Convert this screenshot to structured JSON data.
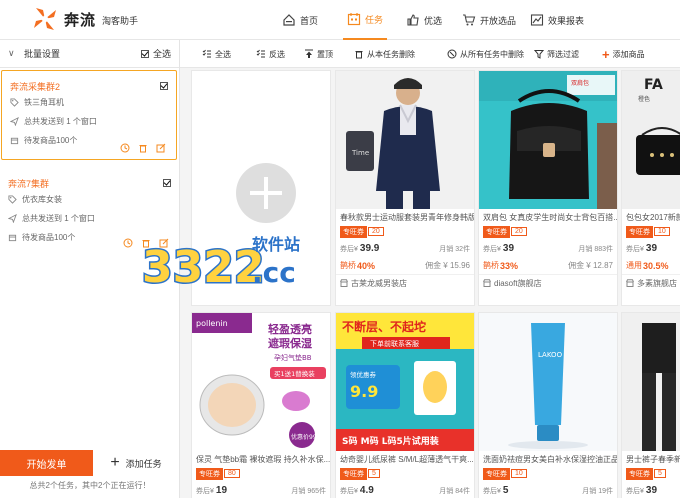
{
  "brand": {
    "name": "奔流",
    "subtitle": "淘客助手",
    "logo_icon": "pinwheel-logo",
    "accent": "#f5891f"
  },
  "nav": [
    {
      "label": "首页",
      "icon": "home-icon"
    },
    {
      "label": "任务",
      "icon": "calendar-icon",
      "active": true
    },
    {
      "label": "优选",
      "icon": "thumbs-up-icon"
    },
    {
      "label": "开放选品",
      "icon": "cart-icon"
    },
    {
      "label": "效果报表",
      "icon": "report-icon"
    }
  ],
  "left": {
    "batch_label": "批量设置",
    "select_all": "全选",
    "groups": [
      {
        "title": "奔流采集群2",
        "item": "铁三角耳机",
        "send": "总共发送到 1 个窗口",
        "pending": "待发商品100个",
        "checked": true
      },
      {
        "title": "奔流7集群",
        "item": "优衣库女装",
        "send": "总共发送到 1 个窗口",
        "pending": "待发商品100个",
        "checked": true
      }
    ],
    "start_button": "开始发单",
    "add_task": "添加任务",
    "footer": "总共2个任务，其中2个正在运行！"
  },
  "toolbar": {
    "items": [
      {
        "label": "全选",
        "icon": "checklist-icon"
      },
      {
        "label": "反选",
        "icon": "checklist-icon"
      },
      {
        "label": "置顶",
        "icon": "to-top-icon"
      },
      {
        "label": "从本任务删除",
        "icon": "trash-icon"
      },
      {
        "label": "从所有任务中删除",
        "icon": "delete-all-icon"
      },
      {
        "label": "筛选过滤",
        "icon": "filter-icon"
      },
      {
        "label": "添加商品",
        "icon": "plus-icon"
      }
    ]
  },
  "products": [
    {
      "title": "春秋款男士运动服套装男青年修身韩版...",
      "tag": "专旺券",
      "coupon": "20",
      "price_label": "券后¥",
      "price": "39.9",
      "monthly": "月销 32件",
      "rate_label": "鹊桥",
      "rate": "40%",
      "commission": "佣金 ¥ 15.96",
      "shop": "古莱龙威男装店",
      "image": "man-sportswear"
    },
    {
      "title": "双肩包 女真皮学生时尚女士背包百搭...",
      "tag": "专旺券",
      "coupon": "20",
      "price_label": "券后¥",
      "price": "39",
      "monthly": "月销 883件",
      "rate_label": "鹊桥",
      "rate": "33%",
      "commission": "佣金 ¥ 12.87",
      "shop": "diasoft旗舰店",
      "image": "black-backpack"
    },
    {
      "title": "包包女2017新款...",
      "tag": "专旺券",
      "coupon": "10",
      "price_label": "券后¥",
      "price": "39",
      "monthly": "",
      "rate_label": "通用",
      "rate": "30.5%",
      "commission": "",
      "shop": "多素旗舰店",
      "image": "fashion-bag"
    },
    {
      "title": "保灵 气垫bb霜 裸妆遮瑕 持久补水保...",
      "tag": "专旺券",
      "coupon": "80",
      "price_label": "券后¥",
      "price": "19",
      "monthly": "月销 965件",
      "image": "cushion-bb",
      "banner_title": "轻盈透亮 遮瑕保湿",
      "banner_sub": "孕妇气垫BB",
      "banner_offer": "买1送1替换装",
      "banner_price": "优惠价99.0",
      "brand_text": "pollenin"
    },
    {
      "title": "幼奇婴儿纸尿裤 S/M/L超薄透气干爽...",
      "tag": "专旺券",
      "coupon": "5",
      "price_label": "券后¥",
      "price": "4.9",
      "monthly": "月销 84件",
      "image": "diaper-ad",
      "banner_title": "不断层、不起坨",
      "banner_sub": "下单前联系客服",
      "banner_coupon": "领优惠券 9.9 元",
      "banner_bottom": "S码 M码 L码5片试用装"
    },
    {
      "title": "洗面奶祛痘男女美白补水保湿控油正品...",
      "tag": "专旺券",
      "coupon": "10",
      "price_label": "券后¥",
      "price": "5",
      "monthly": "月销 19件",
      "image": "cleanser-tube",
      "brand_text": "LAKOO"
    },
    {
      "title": "男士裤子春季新款...",
      "tag": "专旺券",
      "coupon": "5",
      "price_label": "券后¥",
      "price": "39",
      "monthly": "",
      "image": "man-pants"
    }
  ],
  "watermark": {
    "number": "3322",
    "site": "软件站",
    "domain": ".cc"
  }
}
